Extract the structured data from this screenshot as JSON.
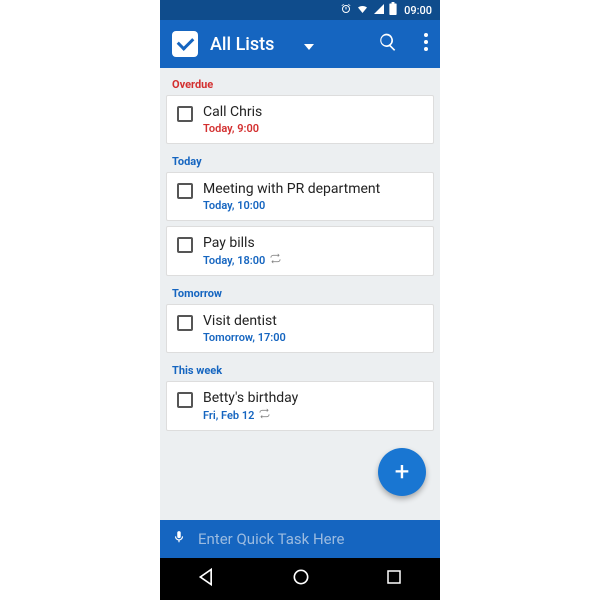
{
  "status": {
    "time": "09:00"
  },
  "header": {
    "title": "All Lists"
  },
  "sections": [
    {
      "label": "Overdue",
      "class": "overdue-h"
    },
    {
      "label": "Today",
      "class": "today-h"
    },
    {
      "label": "Tomorrow",
      "class": "tomorrow-h"
    },
    {
      "label": "This week",
      "class": "week-h"
    }
  ],
  "tasks": {
    "overdue": [
      {
        "title": "Call Chris",
        "time": "Today, 9:00",
        "timeClass": "time-overdue",
        "repeat": false
      }
    ],
    "today": [
      {
        "title": "Meeting with PR department",
        "time": "Today, 10:00",
        "timeClass": "time-normal",
        "repeat": false
      },
      {
        "title": "Pay bills",
        "time": "Today, 18:00",
        "timeClass": "time-normal",
        "repeat": true
      }
    ],
    "tomorrow": [
      {
        "title": "Visit dentist",
        "time": "Tomorrow, 17:00",
        "timeClass": "time-normal",
        "repeat": false
      }
    ],
    "thisweek": [
      {
        "title": "Betty's birthday",
        "time": "Fri, Feb 12",
        "timeClass": "time-normal",
        "repeat": true
      }
    ]
  },
  "quickTask": {
    "placeholder": "Enter Quick Task Here"
  },
  "fab": {
    "label": "+"
  }
}
